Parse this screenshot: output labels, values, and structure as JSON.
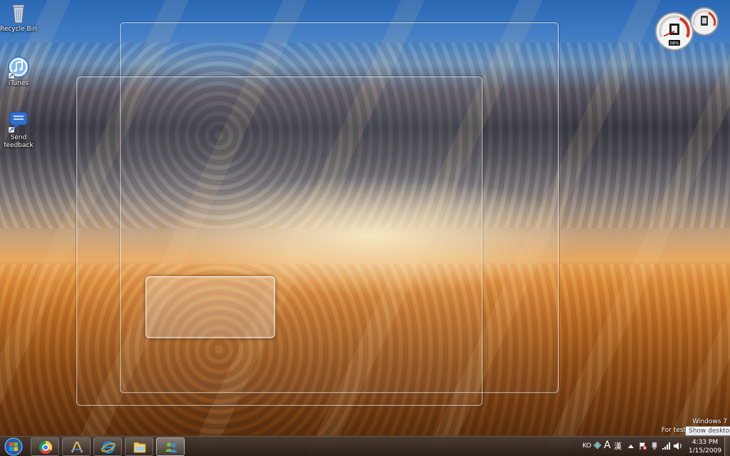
{
  "desktop": {
    "icons": [
      {
        "label": "Recycle Bin",
        "icon": "recycle-bin-icon"
      },
      {
        "label": "iTunes",
        "icon": "itunes-icon"
      },
      {
        "label": "Send feedback",
        "icon": "feedback-icon"
      }
    ]
  },
  "gadget": {
    "cpu_percent_text": "08%",
    "cpu_fraction": 0.08
  },
  "watermark": {
    "line1": "Windows 7",
    "line2": "For testing purposes"
  },
  "taskbar": {
    "pinned": [
      {
        "icon": "chrome-icon"
      },
      {
        "icon": "autodesk-icon"
      },
      {
        "icon": "internet-explorer-icon"
      },
      {
        "icon": "windows-explorer-icon"
      },
      {
        "icon": "windows-live-messenger-icon"
      }
    ],
    "tray": {
      "language": "KO",
      "ime_char_1": "A",
      "ime_char_2": "漢"
    },
    "clock": {
      "time": "4:33 PM",
      "date": "1/15/2009"
    },
    "tooltip": "Show desktop"
  },
  "colors": {
    "sky_blue": "#2a68b5",
    "horizon_orange": "#e7a860",
    "taskbar": "#3a2d26"
  }
}
